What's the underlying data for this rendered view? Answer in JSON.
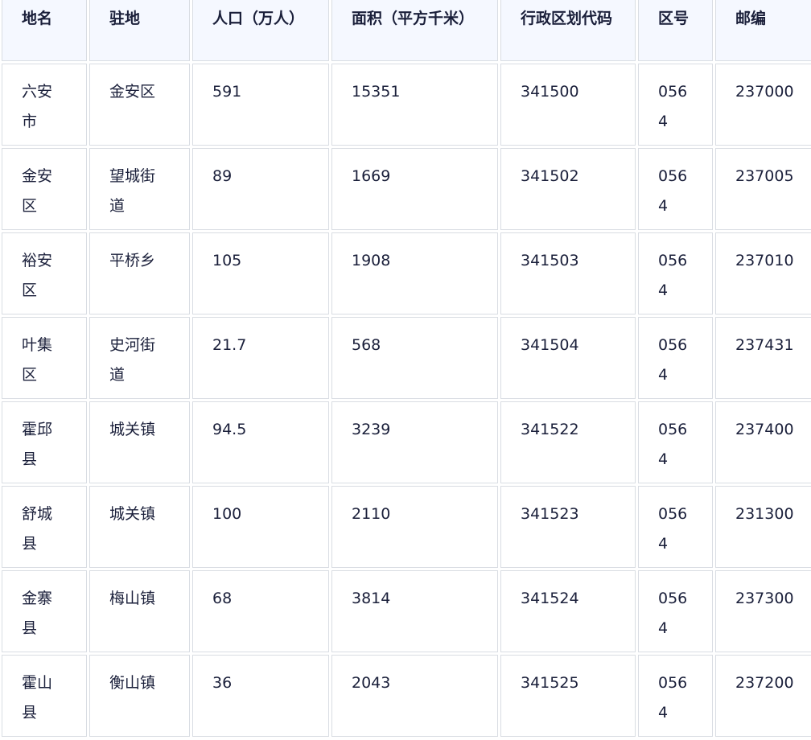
{
  "table": {
    "headers": [
      "地名",
      "驻地",
      "人口（万人）",
      "面积（平方千米）",
      "行政区划代码",
      "区号",
      "邮编"
    ],
    "rows": [
      [
        "六安市",
        "金安区",
        "591",
        "15351",
        "341500",
        "0564",
        "237000"
      ],
      [
        "金安区",
        "望城街道",
        "89",
        "1669",
        "341502",
        "0564",
        "237005"
      ],
      [
        "裕安区",
        "平桥乡",
        "105",
        "1908",
        "341503",
        "0564",
        "237010"
      ],
      [
        "叶集区",
        "史河街道",
        "21.7",
        "568",
        "341504",
        "0564",
        "237431"
      ],
      [
        "霍邱县",
        "城关镇",
        "94.5",
        "3239",
        "341522",
        "0564",
        "237400"
      ],
      [
        "舒城县",
        "城关镇",
        "100",
        "2110",
        "341523",
        "0564",
        "231300"
      ],
      [
        "金寨县",
        "梅山镇",
        "68",
        "3814",
        "341524",
        "0564",
        "237300"
      ],
      [
        "霍山县",
        "衡山镇",
        "36",
        "2043",
        "341525",
        "0564",
        "237200"
      ]
    ]
  }
}
